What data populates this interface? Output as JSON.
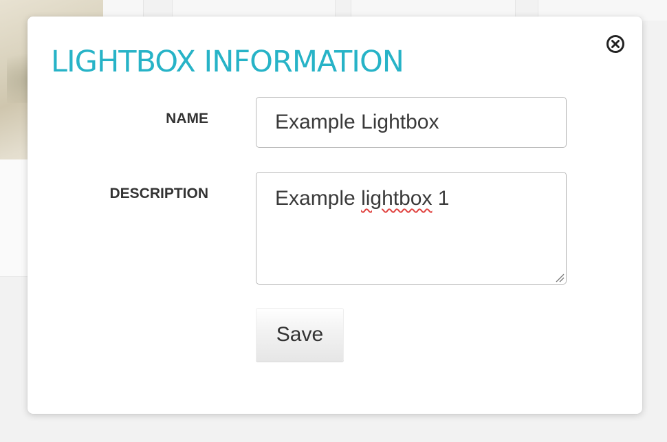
{
  "modal": {
    "title": "LIGHTBOX INFORMATION",
    "close_icon": "close-circle-icon",
    "accent_color": "#27b3c7"
  },
  "form": {
    "name_label": "NAME",
    "name_value": "Example Lightbox",
    "description_label": "DESCRIPTION",
    "description_value_before": "Example ",
    "description_value_misspelled": "lightbox",
    "description_value_after": " 1",
    "save_label": "Save"
  }
}
